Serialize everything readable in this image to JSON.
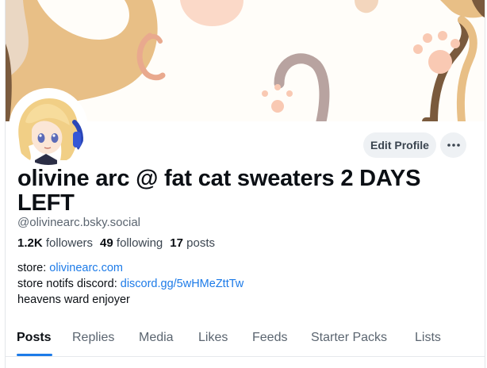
{
  "profile": {
    "display_name": "olivine arc @ fat cat sweaters 2 DAYS LEFT",
    "handle": "@olivinearc.bsky.social",
    "stats": {
      "followers_count": "1.2K",
      "followers_label": "followers",
      "following_count": "49",
      "following_label": "following",
      "posts_count": "17",
      "posts_label": "posts"
    },
    "bio": {
      "line1_prefix": "store: ",
      "line1_link": "olivinearc.com",
      "line2_prefix": "store notifs discord: ",
      "line2_link": "discord.gg/5wHMeZttTw",
      "line3": "heavens ward enjoyer"
    }
  },
  "actions": {
    "edit_profile_label": "Edit Profile",
    "more_icon": "ellipsis-icon"
  },
  "tabs": [
    {
      "label": "Posts",
      "active": true
    },
    {
      "label": "Replies"
    },
    {
      "label": "Media"
    },
    {
      "label": "Likes"
    },
    {
      "label": "Feeds"
    },
    {
      "label": "Starter Packs"
    },
    {
      "label": "Lists"
    }
  ],
  "colors": {
    "accent": "#1d7be8",
    "banner_tan": "#e8bf86",
    "banner_pink": "#f6c9b6",
    "banner_mauve": "#b8a3a0",
    "banner_brown": "#7a5a3d"
  }
}
